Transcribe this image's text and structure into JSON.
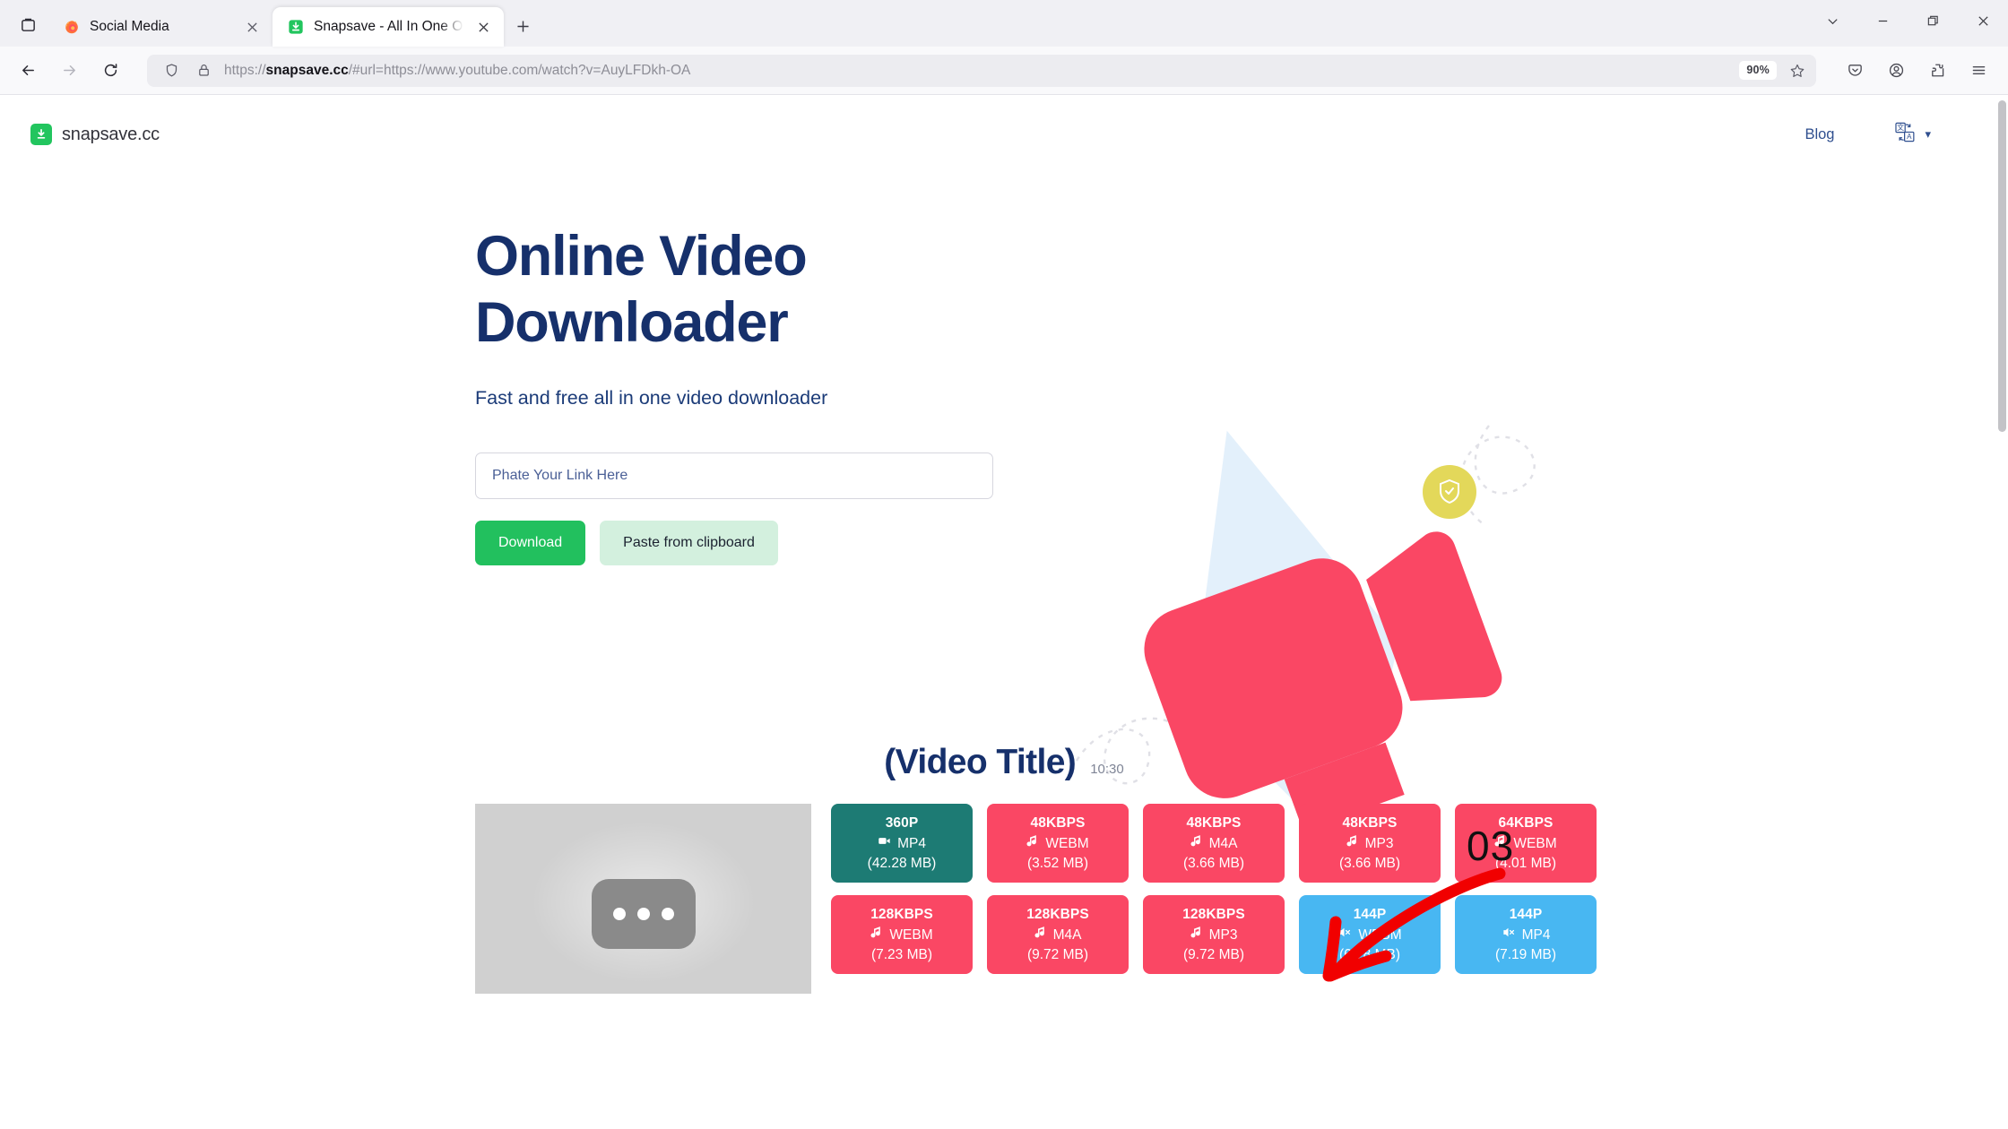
{
  "browser": {
    "tab_list_icon": "tab-list-icon",
    "tabs": [
      {
        "title": "Social Media",
        "favicon": "firefox-icon",
        "active": false
      },
      {
        "title": "Snapsave - All In One Online Video Downloader",
        "favicon": "snapsave-icon",
        "active": true
      }
    ],
    "new_tab_label": "+",
    "window_controls": [
      "tab-overview-icon",
      "minimize-icon",
      "maximize-icon",
      "close-icon"
    ],
    "nav": {
      "back_icon": "back-arrow-icon",
      "forward_icon": "forward-arrow-icon",
      "reload_icon": "reload-icon",
      "shield_icon": "shield-icon",
      "lock_icon": "padlock-icon",
      "url_prefix": "https://",
      "url_domain": "snapsave.cc",
      "url_suffix": "/#url=https://www.youtube.com/watch?v=AuyLFDkh-OA",
      "zoom_level": "90%",
      "bookmark_icon": "star-icon",
      "right_icons": [
        "pocket-save-icon",
        "account-icon",
        "extensions-icon",
        "app-menu-icon"
      ]
    }
  },
  "site": {
    "logo_text": "snapsave.cc",
    "logo_icon": "download-box-icon",
    "nav": {
      "blog_label": "Blog",
      "language_icon": "translate-icon",
      "language_caret": "▾"
    },
    "hero": {
      "title_line1": "Online Video",
      "title_line2": "Downloader",
      "subtitle": "Fast and free all in one video downloader",
      "input_placeholder": "Phate Your Link Here",
      "input_value": "",
      "download_label": "Download",
      "paste_label": "Paste from clipboard",
      "art": {
        "camera_icon": "video-camera-illustration",
        "shield_badge_icon": "shield-check-icon",
        "cloud_badge_icon": "cloud-download-icon"
      }
    },
    "result": {
      "title": "(Video Title)",
      "duration": "10:30",
      "thumbnail_icon": "image-placeholder-icon",
      "formats": [
        {
          "quality": "360P",
          "format": "MP4",
          "size": "(42.28 MB)",
          "icon": "video-icon",
          "color": "teal"
        },
        {
          "quality": "48KBPS",
          "format": "WEBM",
          "size": "(3.52 MB)",
          "icon": "music-note-icon",
          "color": "pink"
        },
        {
          "quality": "48KBPS",
          "format": "M4A",
          "size": "(3.66 MB)",
          "icon": "music-note-icon",
          "color": "pink"
        },
        {
          "quality": "48KBPS",
          "format": "MP3",
          "size": "(3.66 MB)",
          "icon": "music-note-icon",
          "color": "pink"
        },
        {
          "quality": "64KBPS",
          "format": "WEBM",
          "size": "(4.01 MB)",
          "icon": "music-note-icon",
          "color": "pink"
        },
        {
          "quality": "128KBPS",
          "format": "WEBM",
          "size": "(7.23 MB)",
          "icon": "music-note-icon",
          "color": "pink"
        },
        {
          "quality": "128KBPS",
          "format": "M4A",
          "size": "(9.72 MB)",
          "icon": "music-note-icon",
          "color": "pink"
        },
        {
          "quality": "128KBPS",
          "format": "MP3",
          "size": "(9.72 MB)",
          "icon": "music-note-icon",
          "color": "pink"
        },
        {
          "quality": "144P",
          "format": "WEBM",
          "size": "(6.78 MB)",
          "icon": "muted-speaker-icon",
          "color": "blue"
        },
        {
          "quality": "144P",
          "format": "MP4",
          "size": "(7.19 MB)",
          "icon": "muted-speaker-icon",
          "color": "blue"
        }
      ]
    }
  },
  "annotation": {
    "step_number": "03",
    "arrow_color": "#f10000",
    "arrow_icon": "curved-arrow-icon"
  },
  "colors": {
    "brand_green": "#22c55e",
    "heading_navy": "#16306b",
    "video_teal": "#1d7b74",
    "audio_pink": "#fa4764",
    "mute_blue": "#48b7f2"
  }
}
